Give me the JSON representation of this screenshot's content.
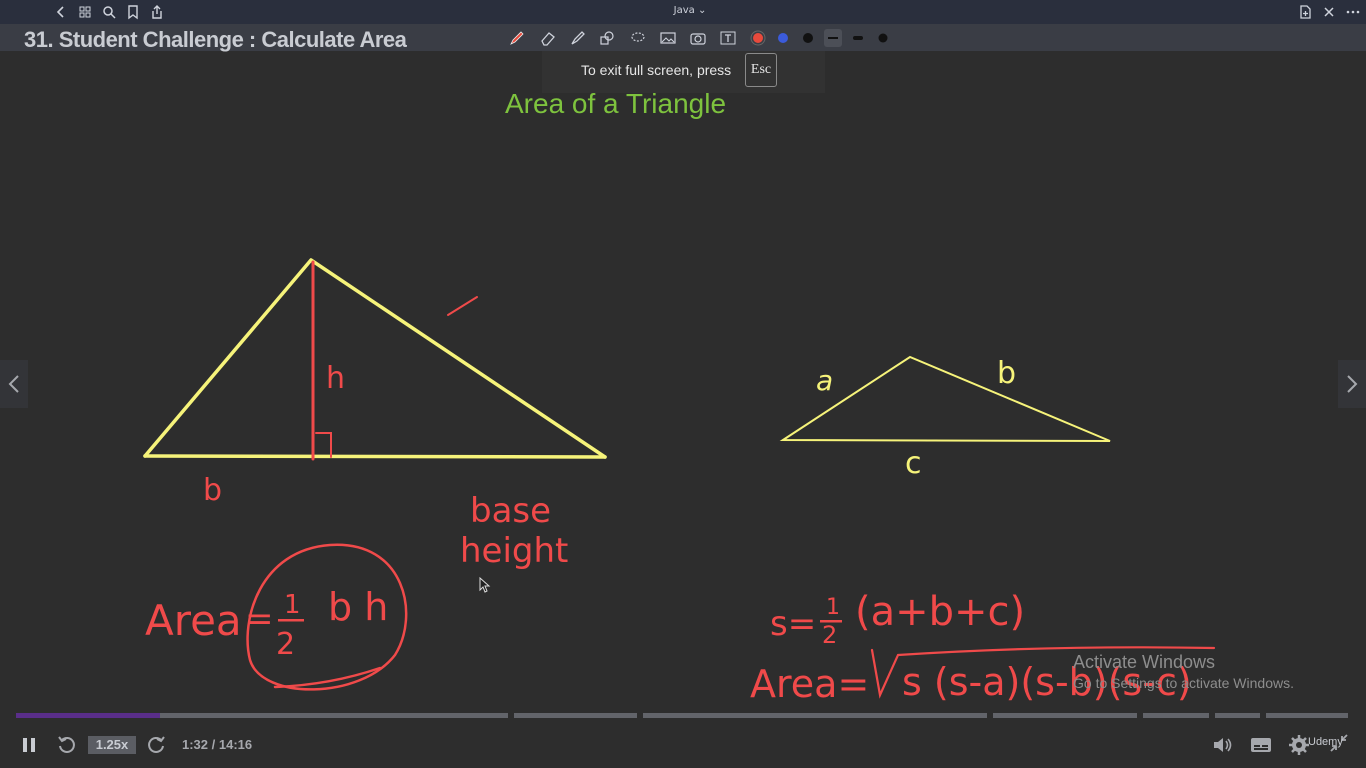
{
  "topbar": {
    "app_title": "Java",
    "icons": [
      "back-icon",
      "grid-icon",
      "search-icon",
      "bookmark-icon",
      "share-icon",
      "new-page-icon",
      "close-icon",
      "more-icon"
    ]
  },
  "video": {
    "title": "31. Student Challenge : Calculate Area"
  },
  "pen_toolbar": {
    "tools": [
      "pen-icon",
      "eraser-icon",
      "highlighter-icon",
      "shapes-icon",
      "lasso-icon",
      "image-icon",
      "camera-icon",
      "text-box-icon"
    ],
    "colors": [
      "#e84a3c",
      "#3b5bdb",
      "#111111"
    ],
    "stroke_widths": [
      "thin",
      "medium",
      "thick"
    ]
  },
  "fullscreen_hint": {
    "message": "To exit full screen, press",
    "key": "Esc"
  },
  "slide": {
    "title": "Area of a Triangle",
    "title_color": "#7ec33e",
    "shape_color": "#f6f37a",
    "ink_color": "#f04a4a"
  },
  "watermark": {
    "line1": "Activate Windows",
    "line2": "Go to Settings to activate Windows."
  },
  "player": {
    "speed": "1.25x",
    "time": "1:32 / 14:16",
    "progress_fraction": 0.108,
    "brand": "Udemy"
  }
}
